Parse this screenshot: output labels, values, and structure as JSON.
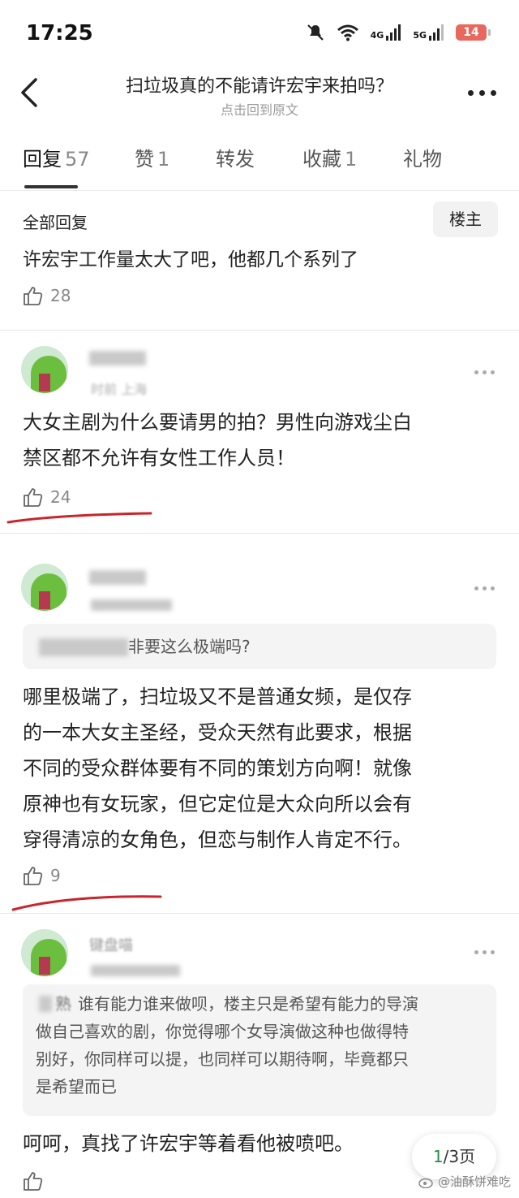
{
  "status_bar": {
    "time": "17:25",
    "net1": "4G",
    "net2": "5G",
    "battery": "14",
    "icons": [
      "mute-icon",
      "wifi-icon",
      "signal-icon",
      "signal-icon",
      "battery-icon"
    ]
  },
  "header": {
    "title": "扫垃圾真的不能请许宏宇来拍吗？",
    "subtitle": "点击回到原文"
  },
  "tabs": [
    {
      "label": "回复",
      "count": "57"
    },
    {
      "label": "赞",
      "count": "1"
    },
    {
      "label": "转发",
      "count": ""
    },
    {
      "label": "收藏",
      "count": "1"
    },
    {
      "label": "礼物",
      "count": ""
    }
  ],
  "section": {
    "title": "全部回复",
    "op_button": "楼主"
  },
  "comment0": {
    "cut_text": "许宏宇工作量太大了吧，他都几个系列了",
    "likes": "28"
  },
  "comment1": {
    "meta": "时前 上海",
    "text_lines": [
      "大女主剧为什么要请男的拍？男性向游戏尘白",
      "禁区都不允许有女性工作人员！"
    ],
    "likes": "24"
  },
  "comment2": {
    "quote": "非要这么极端吗?",
    "text_lines": [
      "哪里极端了，扫垃圾又不是普通女频，是仅存",
      "的一本大女主圣经，受众天然有此要求，根据",
      "不同的受众群体要有不同的策划方向啊！就像",
      "原神也有女玩家，但它定位是大众向所以会有",
      "穿得清凉的女角色，但恋与制作人肯定不行。"
    ],
    "likes": "9"
  },
  "comment3": {
    "name": "键盘喵",
    "quote_author": "熟",
    "quote_lines": [
      "谁有能力谁来做呗，楼主只是希望有能力的导演",
      "做自己喜欢的剧，你觉得哪个女导演做这种也做得特",
      "别好，你同样可以提，也同样可以期待啊，毕竟都只",
      "是希望而已"
    ],
    "text": "呵呵，真找了许宏宇等着看他被喷吧。"
  },
  "pager": {
    "current": "1",
    "total": "/3页"
  },
  "watermark": "@油酥饼难吃",
  "colors": {
    "annotation_red": "#c8262a",
    "page_green": "#2a8a4a",
    "battery": "#e8675e"
  }
}
